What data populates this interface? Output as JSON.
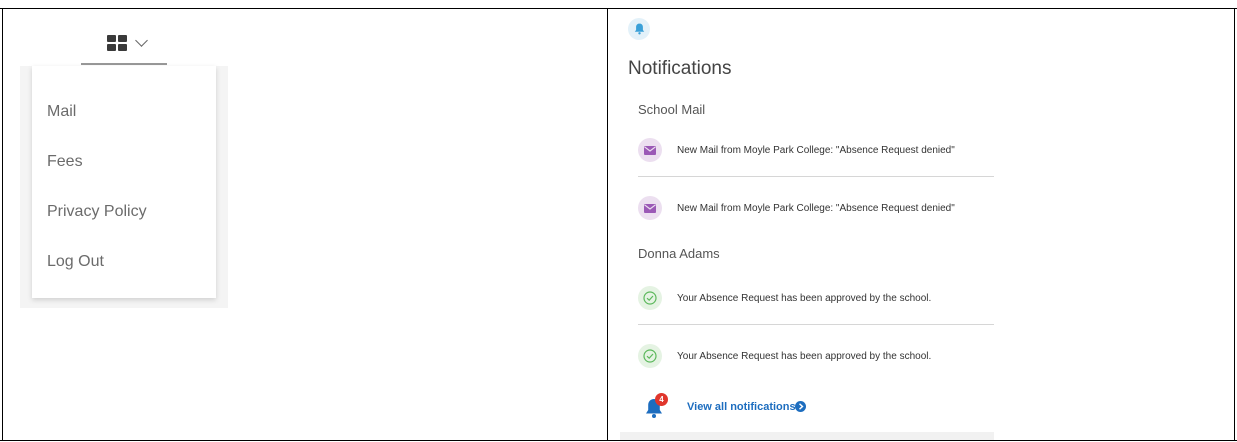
{
  "left_panel": {
    "apps_toggle": {
      "icon": "grid-icon",
      "chevron": "chevron-down-icon"
    },
    "menu": {
      "items": [
        {
          "label": "Mail"
        },
        {
          "label": "Fees"
        },
        {
          "label": "Privacy Policy"
        },
        {
          "label": "Log Out"
        }
      ]
    }
  },
  "right_panel": {
    "header_icon": "bell-icon",
    "title": "Notifications",
    "sections": [
      {
        "label": "School Mail",
        "items": [
          {
            "icon": "mail-icon",
            "text": "New Mail from Moyle Park College: \"Absence Request denied\""
          },
          {
            "icon": "mail-icon",
            "text": "New Mail from Moyle Park College: \"Absence Request denied\""
          }
        ]
      },
      {
        "label": "Donna Adams",
        "items": [
          {
            "icon": "check-circle-icon",
            "text": "Your Absence Request has been approved by the school."
          },
          {
            "icon": "check-circle-icon",
            "text": "Your Absence Request has been approved by the school."
          }
        ]
      }
    ],
    "footer": {
      "badge_count": "4",
      "view_all_label": "View all notifications"
    }
  },
  "colors": {
    "accent_blue": "#1d6dbf",
    "badge_red": "#e0362c",
    "mail_purple": "#9b59b6",
    "check_green": "#5cb85c"
  }
}
